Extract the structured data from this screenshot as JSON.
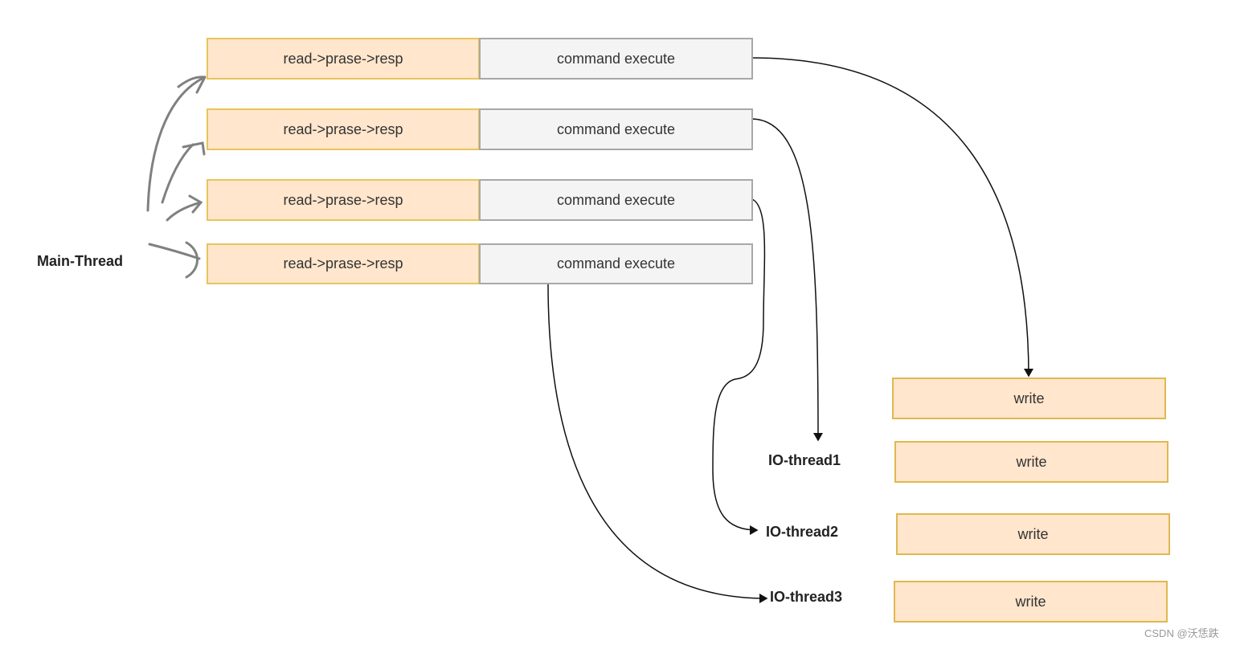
{
  "main_thread_label": "Main-Thread",
  "rows": [
    {
      "stage": "read->prase->resp",
      "execute": "command execute"
    },
    {
      "stage": "read->prase->resp",
      "execute": "command execute"
    },
    {
      "stage": "read->prase->resp",
      "execute": "command execute"
    },
    {
      "stage": "read->prase->resp",
      "execute": "command execute"
    }
  ],
  "io_threads": [
    "IO-thread1",
    "IO-thread2",
    "IO-thread3"
  ],
  "writes": [
    "write",
    "write",
    "write",
    "write"
  ],
  "watermark": "CSDN @沃恁跌",
  "colors": {
    "stage_fill": "#ffe6cc",
    "stage_border": "#e8c45a",
    "execute_fill": "#f4f4f4",
    "execute_border": "#a8a8a8",
    "arrow": "#111111",
    "hand_arrow": "#808080"
  }
}
